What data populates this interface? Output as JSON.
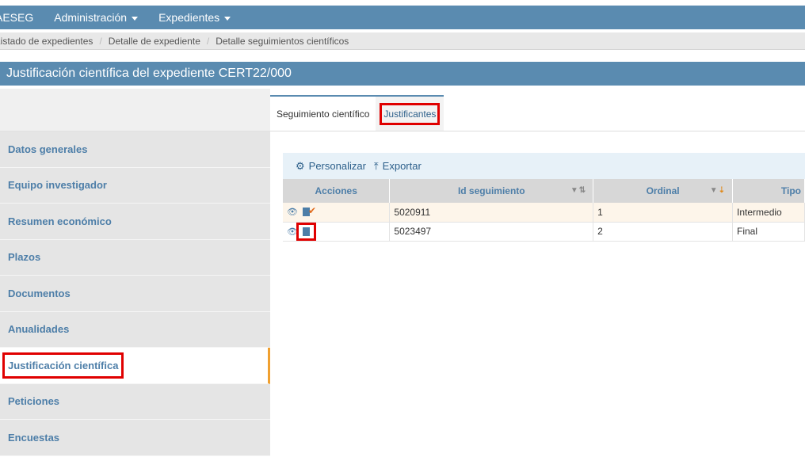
{
  "nav": {
    "brand": "AESEG",
    "items": [
      {
        "label": "Administración"
      },
      {
        "label": "Expedientes"
      }
    ]
  },
  "breadcrumb": [
    "Listado de expedientes",
    "Detalle de expediente",
    "Detalle seguimientos científicos"
  ],
  "title": "Justificación científica del expediente CERT22/000",
  "sidebar": {
    "items": [
      {
        "label": "Datos generales"
      },
      {
        "label": "Equipo investigador"
      },
      {
        "label": "Resumen económico"
      },
      {
        "label": "Plazos"
      },
      {
        "label": "Documentos"
      },
      {
        "label": "Anualidades"
      },
      {
        "label": "Justificación científica"
      },
      {
        "label": "Peticiones"
      },
      {
        "label": "Encuestas"
      }
    ]
  },
  "tabs": [
    {
      "label": "Seguimiento científico"
    },
    {
      "label": "Justificantes"
    }
  ],
  "toolbar": {
    "personalizar": "Personalizar",
    "exportar": "Exportar"
  },
  "table": {
    "headers": [
      "Acciones",
      "Id seguimiento",
      "Ordinal",
      "Tipo"
    ],
    "rows": [
      {
        "id": "5020911",
        "ordinal": "1",
        "tipo": "Intermedio"
      },
      {
        "id": "5023497",
        "ordinal": "2",
        "tipo": "Final"
      }
    ]
  },
  "icons": {
    "settings": "gear-icon",
    "export": "export-icon",
    "view": "eye-icon",
    "document": "document-icon"
  },
  "colors": {
    "primary": "#5a8bb0",
    "highlight": "#e00000",
    "active_accent": "#f0a030"
  }
}
